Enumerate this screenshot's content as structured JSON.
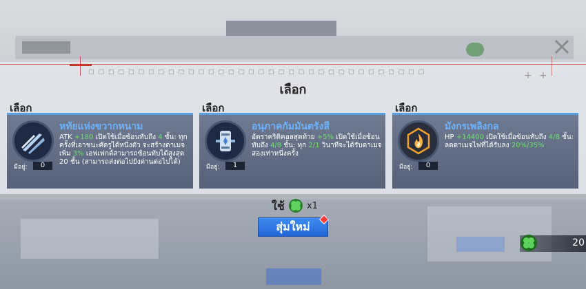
{
  "popup": {
    "title": "เลือก",
    "use_label": "ใช้",
    "use_count": "x1",
    "button_label": "สุ่มใหม่"
  },
  "cards": [
    {
      "label": "เลือก",
      "name": "หทัยแห่งขวากหนาม",
      "desc_html": "ATK <span class='g'>+180</span> เปิดใช้เมื่อซ้อนทับถึง <span class='g'>4</span> ชั้น: ทุกครั้งที่เอาชนะศัตรูได้หนึ่งตัว จะสร้างดาเมจเพิ่ม <span class='g'>3%</span> เอฟเฟกต์สามารถซ้อนทับได้สูงสุด 20 ชั้น (สามารถส่งต่อไปยังด่านต่อไปได้)",
      "owned_label": "มีอยู่:",
      "owned_value": "0",
      "icon": "blades-icon",
      "accent": "#6fb3ff"
    },
    {
      "label": "เลือก",
      "name": "อนุภาคกัมมันตรังสี",
      "desc_html": "อัตราคริติคอลสุดท้าย <span class='g'>+5%</span> เปิดใช้เมื่อซ้อนทับถึง <span class='g'>4/8</span> ชั้น: ทุก <span class='g'>2/1</span> วินาทีจะได้รับดาเมจสองเท่าหนึ่งครั้ง",
      "owned_label": "มีอยู่:",
      "owned_value": "1",
      "icon": "canister-icon",
      "accent": "#6fb3ff"
    },
    {
      "label": "เลือก",
      "name": "มังกรเพลิงกล",
      "desc_html": "HP <span class='g'>+14400</span> เปิดใช้เมื่อซ้อนทับถึง <span class='g'>4/8</span> ชั้น: ลดดาเมจไฟที่ได้รับลง <span class='g'>20%/35%</span>",
      "owned_label": "มีอยู่:",
      "owned_value": "0",
      "icon": "flame-icon",
      "accent": "#6fb3ff"
    }
  ],
  "currency": {
    "icon": "clover-icon",
    "value": "20"
  },
  "colors": {
    "card_top": "#5aa0e6",
    "highlight": "#6ee06e",
    "button": "#2f7be6"
  }
}
